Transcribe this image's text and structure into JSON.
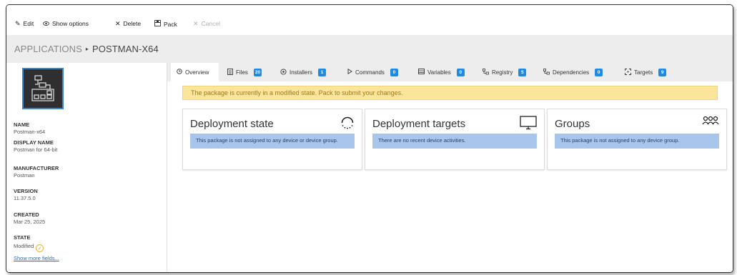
{
  "toolbar": {
    "edit": "Edit",
    "show_options": "Show options",
    "delete": "Delete",
    "pack": "Pack",
    "cancel": "Cancel"
  },
  "breadcrumb": {
    "root": "APPLICATIONS",
    "separator": "▸",
    "current": "POSTMAN-X64"
  },
  "details": {
    "name_label": "NAME",
    "name_value": "Postman-x64",
    "display_name_label": "DISPLAY NAME",
    "display_name_value": "Postman for 64-bit",
    "manufacturer_label": "MANUFACTURER",
    "manufacturer_value": "Postman",
    "version_label": "VERSION",
    "version_value": "11.37.5.0",
    "created_label": "CREATED",
    "created_value": "Mar 25, 2025",
    "state_label": "STATE",
    "state_value": "Modified",
    "show_more": "Show more fields..."
  },
  "tabs": [
    {
      "label": "Overview",
      "badge": null,
      "icon": "clock-icon"
    },
    {
      "label": "Files",
      "badge": "20",
      "icon": "file-icon"
    },
    {
      "label": "Installers",
      "badge": "1",
      "icon": "installer-icon"
    },
    {
      "label": "Commands",
      "badge": "0",
      "icon": "play-icon"
    },
    {
      "label": "Variables",
      "badge": "0",
      "icon": "variables-icon"
    },
    {
      "label": "Registry",
      "badge": "5",
      "icon": "registry-icon"
    },
    {
      "label": "Dependencies",
      "badge": "0",
      "icon": "dependencies-icon"
    },
    {
      "label": "Targets",
      "badge": "9",
      "icon": "targets-icon"
    }
  ],
  "notice": "The package is currently in a modified state. Pack to submit your changes.",
  "cards": {
    "deployment_state": {
      "title": "Deployment state",
      "message": "This package is not assigned to any device or device group."
    },
    "deployment_targets": {
      "title": "Deployment targets",
      "message": "There are no recent device activities."
    },
    "groups": {
      "title": "Groups",
      "message": "This package is not assigned to any device group."
    }
  },
  "colors": {
    "accent": "#1e8ae6",
    "notice_bg": "#fae59a",
    "message_bg": "#a8c6ec",
    "state_modified": "#f0b429"
  }
}
